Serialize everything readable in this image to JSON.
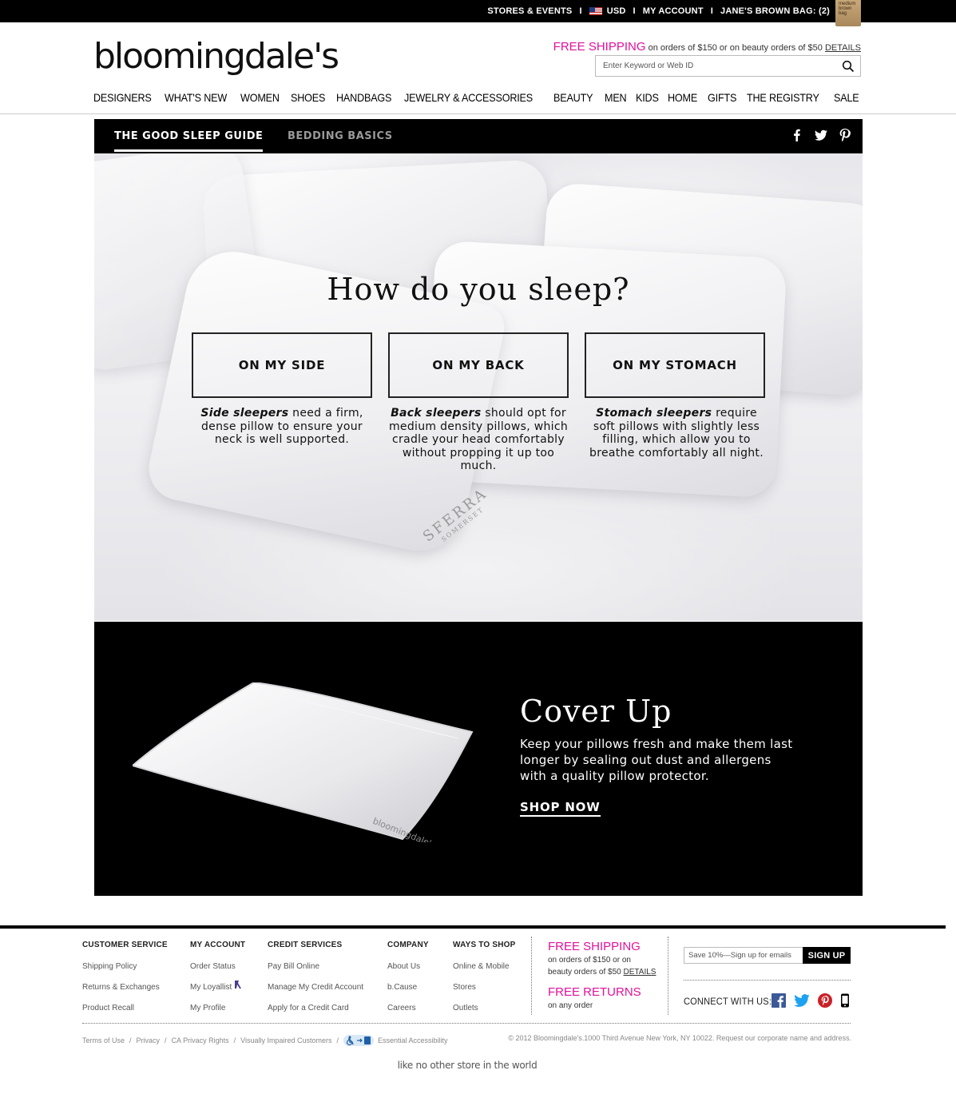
{
  "topbar": {
    "stores": "STORES & EVENTS",
    "currency": "USD",
    "account": "MY ACCOUNT",
    "bag": "JANE'S BROWN BAG: (2)",
    "bag_icon_text": "medium brown bag"
  },
  "header": {
    "logo": "bloomingdale's",
    "shipping_promo": "FREE SHIPPING",
    "shipping_detail": " on orders of $150 or on beauty orders of $50 ",
    "shipping_link": "DETAILS",
    "search_placeholder": "Enter Keyword or Web ID"
  },
  "nav": [
    "DESIGNERS",
    "WHAT'S NEW",
    "WOMEN",
    "SHOES",
    "HANDBAGS",
    "JEWELRY & ACCESSORIES",
    "BEAUTY",
    "MEN",
    "KIDS",
    "HOME",
    "GIFTS",
    "THE REGISTRY",
    "SALE"
  ],
  "tabs": {
    "active": "THE GOOD SLEEP GUIDE",
    "inactive": "BEDDING BASICS"
  },
  "hero": {
    "title": "How do you sleep?",
    "options": [
      {
        "label": "ON MY SIDE",
        "lead": "Side sleepers",
        "text": " need a firm, dense pillow to ensure your neck is well supported."
      },
      {
        "label": "ON MY BACK",
        "lead": "Back sleepers",
        "text": " should opt for medium density pillows, which cradle your head comfortably without propping it up too much."
      },
      {
        "label": "ON MY STOMACH",
        "lead": "Stomach sleepers",
        "text": " require soft pillows with slightly less filling, which allow you to breathe comfortably all night."
      }
    ],
    "pillow_brand": "SFERRA",
    "pillow_model": "SOMERSET"
  },
  "cover": {
    "title": "Cover Up",
    "text": "Keep your pillows fresh and make them last longer by sealing out dust and allergens with a quality pillow protector.",
    "cta": "SHOP NOW",
    "pillow_label": "bloomingdale's"
  },
  "footer": {
    "columns": [
      {
        "title": "CUSTOMER SERVICE",
        "links": [
          "Shipping Policy",
          "Returns & Exchanges",
          "Product Recall"
        ]
      },
      {
        "title": "MY ACCOUNT",
        "links": [
          "Order Status",
          "My Loyallist",
          "My Profile"
        ]
      },
      {
        "title": "CREDIT SERVICES",
        "links": [
          "Pay Bill Online",
          "Manage My Credit Account",
          "Apply for a Credit Card"
        ]
      },
      {
        "title": "COMPANY",
        "links": [
          "About Us",
          "b.Cause",
          "Careers"
        ]
      },
      {
        "title": "WAYS TO SHOP",
        "links": [
          "Online & Mobile",
          "Stores",
          "Outlets"
        ]
      }
    ],
    "promo_shipping_title": "FREE SHIPPING",
    "promo_shipping_line1": "on orders of $150 or on",
    "promo_shipping_line2": "beauty orders of $50 ",
    "promo_shipping_link": "DETAILS",
    "promo_returns_title": "FREE RETURNS",
    "promo_returns_text": "on any order",
    "email_placeholder": "Save 10%—Sign up for emails",
    "signup": "SIGN UP",
    "connect": "CONNECT WITH US:",
    "legal": [
      "Terms of Use",
      "Privacy",
      "CA Privacy Rights",
      "Visually Impaired Customers",
      "Essential Accessibility"
    ],
    "copyright": "© 2012 Bloomingdale's.1000 Third Avenue New York, NY 10022. Request our corporate name and address.",
    "tagline": "like no other store in the world"
  },
  "colors": {
    "accent_pink": "#e0119b",
    "black": "#000000"
  }
}
